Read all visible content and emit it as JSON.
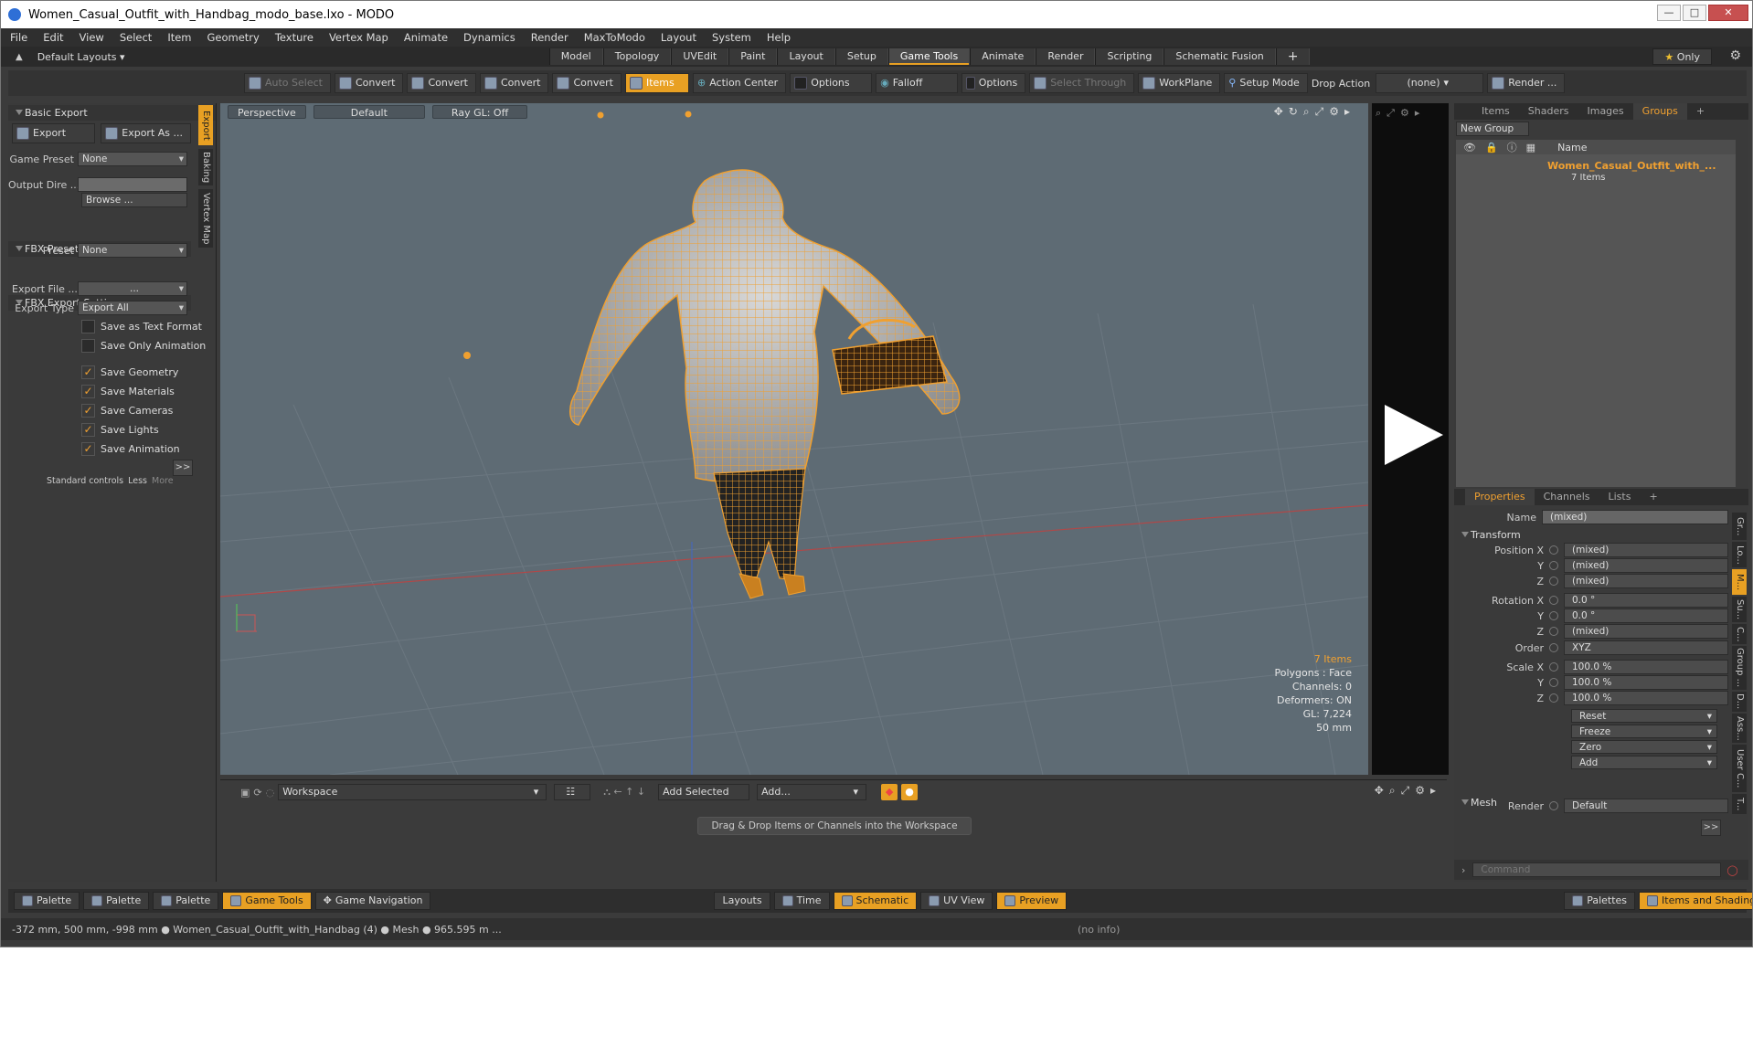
{
  "window": {
    "title": "Women_Casual_Outfit_with_Handbag_modo_base.lxo - MODO"
  },
  "menu": [
    "File",
    "Edit",
    "View",
    "Select",
    "Item",
    "Geometry",
    "Texture",
    "Vertex Map",
    "Animate",
    "Dynamics",
    "Render",
    "MaxToModo",
    "Layout",
    "System",
    "Help"
  ],
  "layouts": {
    "preset": "Default Layouts",
    "tabs": [
      "Model",
      "Topology",
      "UVEdit",
      "Paint",
      "Layout",
      "Setup",
      "Game Tools",
      "Animate",
      "Render",
      "Scripting",
      "Schematic Fusion"
    ],
    "active": "Game Tools",
    "add": "+",
    "only": "Only"
  },
  "toolbar": {
    "auto_select": "Auto Select",
    "convert": "Convert",
    "items": "Items",
    "action_center": "Action Center",
    "options": "Options",
    "falloff": "Falloff",
    "select_through": "Select Through",
    "workplane": "WorkPlane",
    "setup_mode": "Setup Mode",
    "drop_action": "Drop Action",
    "drop_value": "(none)",
    "render": "Render ..."
  },
  "left": {
    "basic_export": "Basic Export",
    "export_btn": "Export",
    "export_as_btn": "Export As ...",
    "game_preset_label": "Game Preset",
    "game_preset_value": "None",
    "output_dir_label": "Output Dire ...",
    "output_dir_value": "",
    "browse": "Browse ...",
    "fbx_preset": "FBX Preset Settings",
    "preset_label": "Preset",
    "preset_value": "None",
    "fbx_export": "FBX Export Settings",
    "export_file_label": "Export File ...",
    "export_file_value": "...",
    "export_type_label": "Export Type",
    "export_type_value": "Export All",
    "save_text": "Save as Text Format",
    "save_only_anim": "Save Only Animation",
    "save_geometry": "Save Geometry",
    "save_materials": "Save Materials",
    "save_cameras": "Save Cameras",
    "save_lights": "Save Lights",
    "save_animation": "Save Animation",
    "more_btn": ">>",
    "standard_controls": "Standard controls",
    "less": "Less",
    "more": "More",
    "side_tabs": [
      "Export",
      "Baking",
      "Vertex Map"
    ]
  },
  "viewport": {
    "perspective": "Perspective",
    "default": "Default",
    "raygl": "Ray GL: Off",
    "items": "7 Items",
    "polygons": "Polygons : Face",
    "channels": "Channels: 0",
    "deformers": "Deformers: ON",
    "gl": "GL: 7,224",
    "mm": "50 mm"
  },
  "groups": {
    "tabs": [
      "Items",
      "Shaders",
      "Images",
      "Groups"
    ],
    "active": "Groups",
    "new_group": "New Group",
    "name_header": "Name",
    "group_name": "Women_Casual_Outfit_with_...",
    "group_items": "7 Items"
  },
  "properties": {
    "tabs": [
      "Properties",
      "Channels",
      "Lists"
    ],
    "active": "Properties",
    "name_label": "Name",
    "name_value": "(mixed)",
    "transform": "Transform",
    "position_x_label": "Position X",
    "position_x": "(mixed)",
    "position_y": "(mixed)",
    "position_z": "(mixed)",
    "rotation_x_label": "Rotation X",
    "rotation_x": "0.0 °",
    "rotation_y": "0.0 °",
    "rotation_z": "(mixed)",
    "order_label": "Order",
    "order_value": "XYZ",
    "scale_x_label": "Scale X",
    "scale_x": "100.0 %",
    "scale_y": "100.0 %",
    "scale_z": "100.0 %",
    "y": "Y",
    "z": "Z",
    "reset": "Reset",
    "freeze": "Freeze",
    "zero": "Zero",
    "add": "Add",
    "mesh": "Mesh",
    "render_label": "Render",
    "render_value": "Default",
    "more": ">>",
    "command_placeholder": "Command",
    "side_tabs": [
      "Gr...",
      "Lo...",
      "M...",
      "Su...",
      "C...",
      "Group ...",
      "D...",
      "Ass...",
      "User C...",
      "T..."
    ]
  },
  "workspace": {
    "label": "Workspace",
    "add_selected": "Add Selected",
    "add": "Add...",
    "hint": "Drag & Drop Items or Channels into the Workspace"
  },
  "bottom": {
    "palette": "Palette",
    "game_tools": "Game Tools",
    "game_navigation": "Game Navigation",
    "layouts": "Layouts",
    "time": "Time",
    "schematic": "Schematic",
    "uv_view": "UV View",
    "preview": "Preview",
    "palettes": "Palettes",
    "items_shading": "Items and Shading"
  },
  "status": {
    "left": "-372 mm, 500 mm, -998 mm ● Women_Casual_Outfit_with_Handbag (4) ● Mesh ● 965.595 m ...",
    "center": "(no info)"
  },
  "colors": {
    "accent": "#e8a023",
    "viewport": "#5e6b74",
    "wire": "#f0a030"
  }
}
